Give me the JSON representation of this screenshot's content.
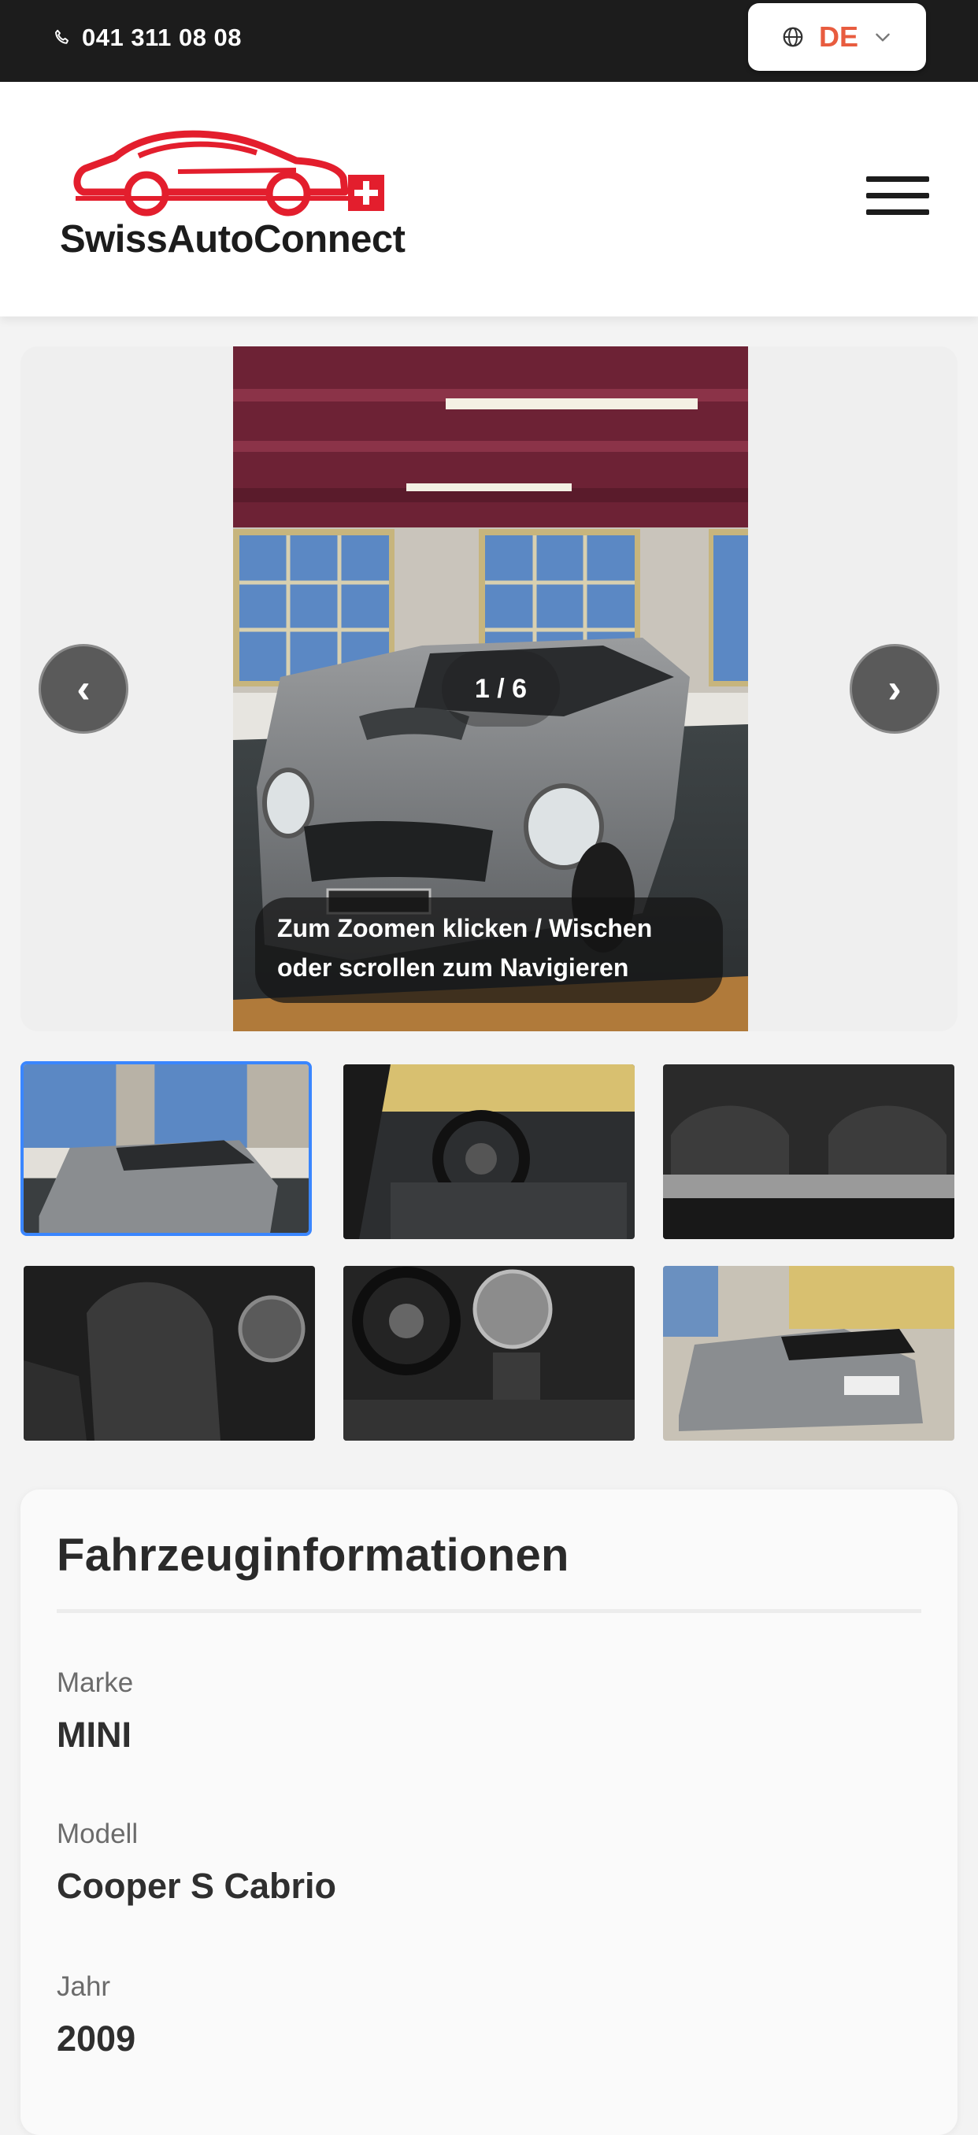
{
  "topbar": {
    "phone": "041 311 08 08",
    "language": "DE"
  },
  "header": {
    "logo_text": "SwissAutoConnect",
    "menu_icon": "hamburger-menu-icon"
  },
  "gallery": {
    "counter": "1 / 6",
    "hint": "Zum Zoomen klicken / Wischen oder scrollen zum Navigieren",
    "prev": "‹",
    "next": "›",
    "thumbnails": 6,
    "active_index": 0
  },
  "vehicle_info": {
    "title": "Fahrzeuginformationen",
    "fields": [
      {
        "label": "Marke",
        "value": "MINI"
      },
      {
        "label": "Modell",
        "value": "Cooper S Cabrio"
      },
      {
        "label": "Jahr",
        "value": "2009"
      }
    ]
  },
  "colors": {
    "accent": "#e85c3f",
    "brand_red": "#e31e2d",
    "dark": "#1c1c1c",
    "active_thumb": "#3a86ff"
  }
}
